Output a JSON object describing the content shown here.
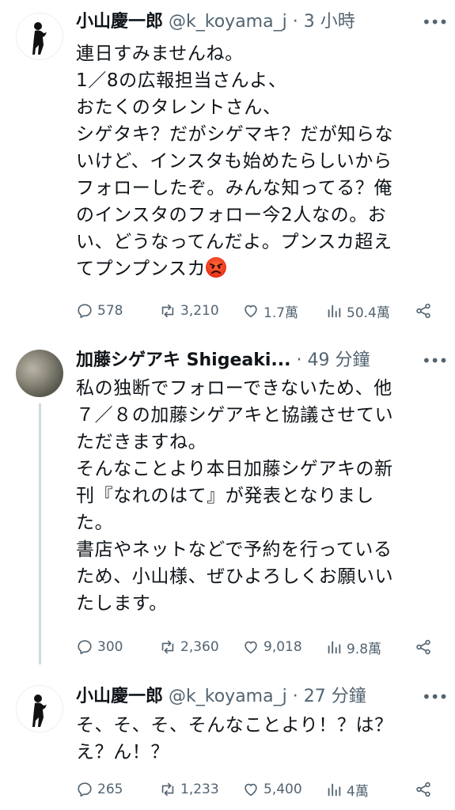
{
  "tweets": [
    {
      "name": "小山慶一郎",
      "handle": "@k_koyama_j",
      "dot": "·",
      "time": "3 小時",
      "text": "連日すみませんね。\n1／8の広報担当さんよ、\nおたくのタレントさん、\nシゲタキ？だがシゲマキ？だが知らな\nいけど、インスタも始めたらしいから\nフォローしたぞ。みんな知ってる？俺\nのインスタのフォロー今2人なの。お\nい、どうなってんだよ。プンスカ超え\nてプンプンスカ",
      "emoji": "angry-face-emoji",
      "replies": "578",
      "retweets": "3,210",
      "likes": "1.7萬",
      "views": "50.4萬"
    },
    {
      "name": "加藤シゲアキ Shigeaki...",
      "handle": "",
      "dot": "·",
      "time": "49 分鐘",
      "text": "私の独断でフォローできないため、他\n７／８の加藤シゲアキと協議させてい\nただきますね。\nそんなことより本日加藤シゲアキの新\n刊『なれのはて』が発表となりまし\nた。\n書店やネットなどで予約を行っている\nため、小山様、ぜひよろしくお願いい\nたします。",
      "replies": "300",
      "retweets": "2,360",
      "likes": "9,018",
      "views": "9.8萬"
    },
    {
      "name": "小山慶一郎",
      "handle": "@k_koyama_j",
      "dot": "·",
      "time": "27 分鐘",
      "text": "そ、そ、そ、そんなことより！？は？\nえ？ん！？",
      "replies": "265",
      "retweets": "1,233",
      "likes": "5,400",
      "views": "4萬"
    }
  ],
  "more_label": "•••",
  "colors": {
    "text": "#0f1419",
    "secondary": "#536471",
    "thread_line": "#cfd9de"
  }
}
